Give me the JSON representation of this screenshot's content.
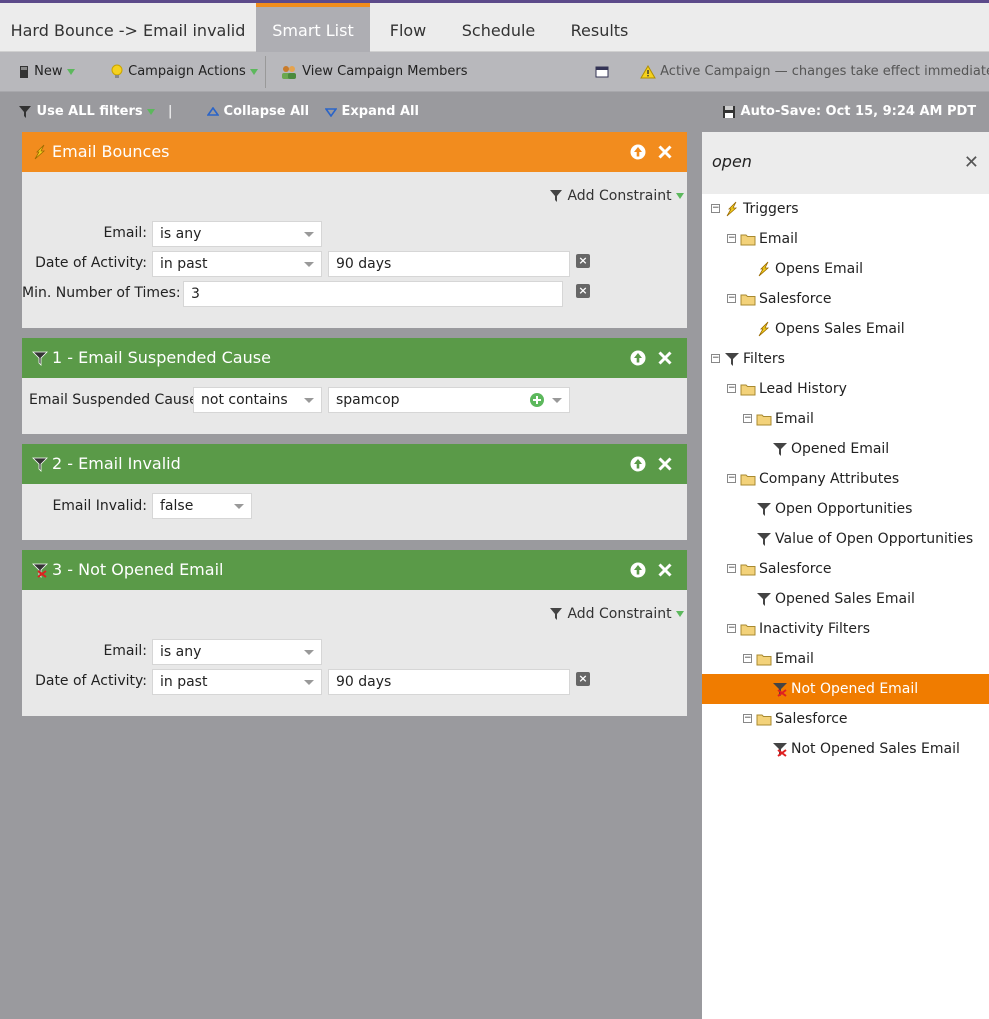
{
  "tabs": {
    "title": "Hard Bounce -> Email invalid",
    "smart_list": "Smart List",
    "flow": "Flow",
    "schedule": "Schedule",
    "results": "Results"
  },
  "toolbar": {
    "new": "New",
    "campaign_actions": "Campaign Actions",
    "view_members": "View Campaign Members",
    "active_notice": "Active Campaign — changes take effect immediately"
  },
  "filterbar": {
    "use_prefix": "Use ",
    "use_all": "ALL",
    "use_suffix": " filters",
    "pipe": "|",
    "collapse": "Collapse All",
    "expand": "Expand All",
    "autosave": "Auto-Save: Oct 15, 9:24 AM PDT"
  },
  "cards": {
    "c0": {
      "title": "Email Bounces",
      "add_constraint": "Add Constraint",
      "email_label": "Email:",
      "email_value": "is any",
      "date_label": "Date of Activity:",
      "date_value": "in past",
      "date_days": "90 days",
      "min_label": "Min. Number of Times:",
      "min_value": "3"
    },
    "c1": {
      "title": "1 - Email Suspended Cause",
      "label": "Email Suspended Cause:",
      "op": "not contains",
      "value": "spamcop"
    },
    "c2": {
      "title": "2 - Email Invalid",
      "label": "Email Invalid:",
      "value": "false"
    },
    "c3": {
      "title": "3 - Not Opened Email",
      "add_constraint": "Add Constraint",
      "email_label": "Email:",
      "email_value": "is any",
      "date_label": "Date of Activity:",
      "date_value": "in past",
      "date_days": "90 days"
    }
  },
  "sidebar": {
    "search": "open",
    "tree": {
      "t0": "Triggers",
      "t1": "Email",
      "t2": "Opens Email",
      "t3": "Salesforce",
      "t4": "Opens Sales Email",
      "t5": "Filters",
      "t6": "Lead History",
      "t7": "Email",
      "t8": "Opened Email",
      "t9": "Company Attributes",
      "t10": "Open Opportunities",
      "t11": "Value of Open Opportunities",
      "t12": "Salesforce",
      "t13": "Opened Sales Email",
      "t14": "Inactivity Filters",
      "t15": "Email",
      "t16": "Not Opened Email",
      "t17": "Salesforce",
      "t18": "Not Opened Sales Email"
    }
  },
  "colors": {
    "accent_orange": "#f28c1e",
    "filter_green": "#5a9a48",
    "selected_orange": "#f07c00"
  }
}
